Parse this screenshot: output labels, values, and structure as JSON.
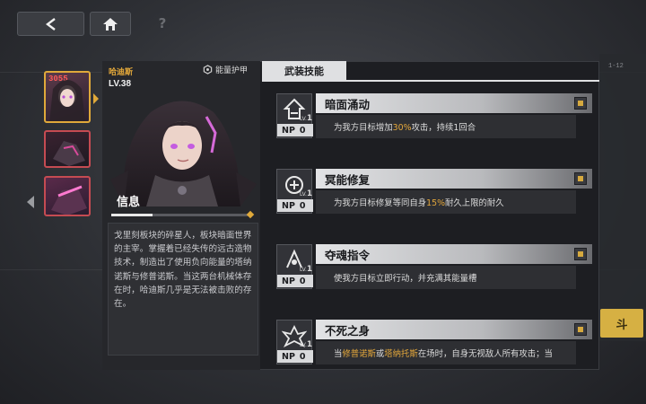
{
  "nav": {
    "back_symbol": "<",
    "help_symbol": "?"
  },
  "background": {
    "stage_tag": "1-12",
    "yellow_button": "斗"
  },
  "slots": [
    {
      "number": "3055"
    },
    {
      "number": ""
    },
    {
      "number": ""
    }
  ],
  "character": {
    "name": "哈迪斯",
    "level": "LV.38",
    "armor_label": "能量护甲",
    "info_label": "信息",
    "info_text": "戈里刻板块的碎星人，板块暗面世界的主宰。掌握着已经失传的远古造物技术，制造出了使用负向能量的塔纳诺斯与修普诺斯。当这两台机械体存在时，哈迪斯几乎是无法被击败的存在。"
  },
  "tab": {
    "label": "武装技能"
  },
  "skills": [
    {
      "name": "暗面涌动",
      "lv_prefix": "LV.",
      "lv": "1",
      "np": "NP",
      "np_value": "0",
      "desc_before": "为我方目标增加",
      "desc_hl": "30%",
      "desc_after": "攻击，持续1回合",
      "desc_hl2": "",
      "desc_after2": ""
    },
    {
      "name": "冥能修复",
      "lv_prefix": "LV.",
      "lv": "1",
      "np": "NP",
      "np_value": "0",
      "desc_before": "为我方目标修复等同自身",
      "desc_hl": "15%",
      "desc_after": "耐久上限的耐久",
      "desc_hl2": "",
      "desc_after2": ""
    },
    {
      "name": "夺魂指令",
      "lv_prefix": "LV.",
      "lv": "1",
      "np": "NP",
      "np_value": "0",
      "desc_before": "使我方目标立即行动，并充满其能量槽",
      "desc_hl": "",
      "desc_after": "",
      "desc_hl2": "",
      "desc_after2": ""
    },
    {
      "name": "不死之身",
      "lv_prefix": "LV.",
      "lv": "1",
      "np": "NP",
      "np_value": "0",
      "desc_before": "当",
      "desc_hl": "修普诺斯",
      "desc_after": "或",
      "desc_hl2": "塔纳托斯",
      "desc_after2": "在场时，自身无视敌人所有攻击；当"
    }
  ],
  "colors": {
    "accent": "#e0a93a",
    "highlight": "#e6a93c",
    "alert": "#c54b52"
  }
}
